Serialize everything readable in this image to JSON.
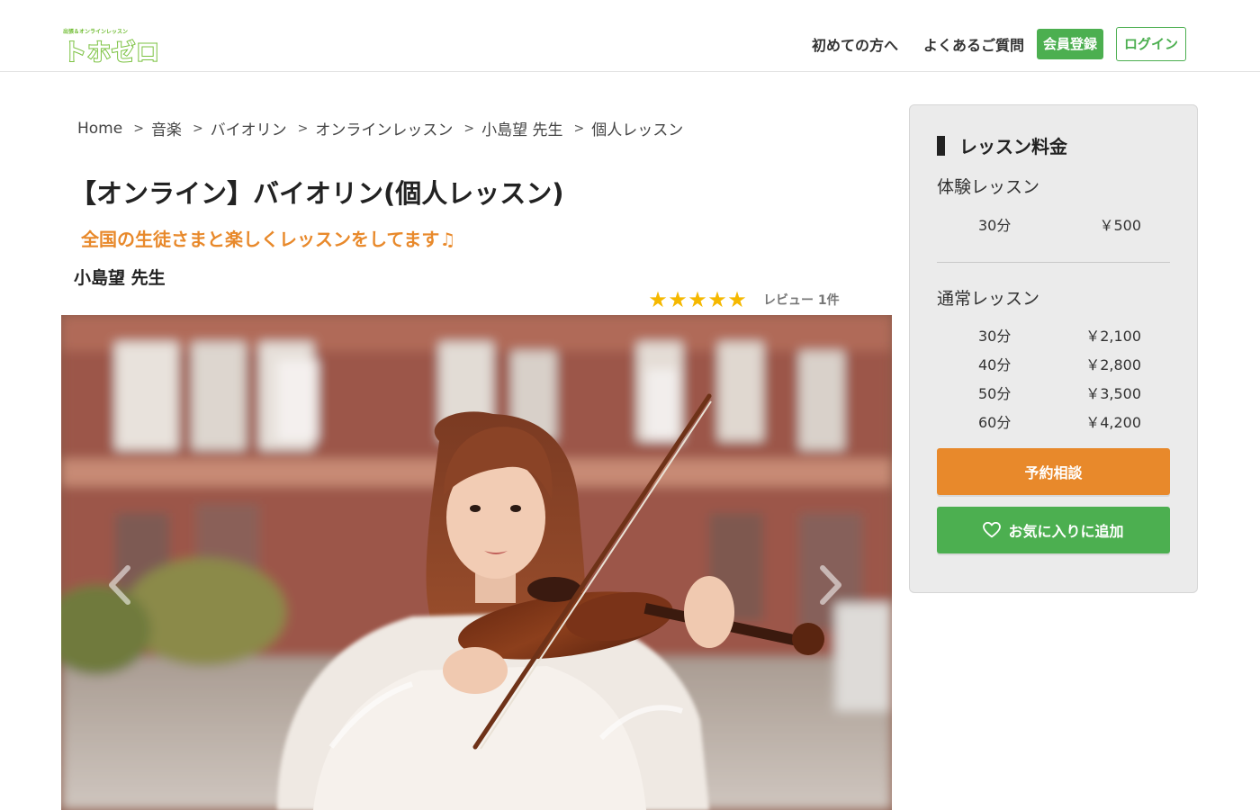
{
  "header": {
    "logo_tagline": "出張＆オンラインレッスン",
    "logo_text": "トホゼロ",
    "nav_first_time": "初めての方へ",
    "nav_faq": "よくあるご質問",
    "register_label": "会員登録",
    "login_label": "ログイン"
  },
  "breadcrumb": {
    "items": [
      "Home",
      "音楽",
      "バイオリン",
      "オンラインレッスン",
      "小島望 先生",
      "個人レッスン"
    ],
    "separator": ">"
  },
  "lesson": {
    "title": "【オンライン】バイオリン(個人レッスン)",
    "catch_copy": "全国の生徒さまと楽しくレッスンをしてます♫",
    "teacher": "小島望 先生",
    "rating": 5,
    "rating_max": 5,
    "review_label": "レビュー 1件"
  },
  "gallery": {
    "photo": "woman-playing-violin-photo",
    "prev_icon": "chevron-left-icon",
    "next_icon": "chevron-right-icon"
  },
  "pricing": {
    "title": "レッスン料金",
    "trial": {
      "label": "体験レッスン",
      "rows": [
        {
          "duration": "30分",
          "price": "￥500"
        }
      ]
    },
    "regular": {
      "label": "通常レッスン",
      "rows": [
        {
          "duration": "30分",
          "price": "￥2,100"
        },
        {
          "duration": "40分",
          "price": "￥2,800"
        },
        {
          "duration": "50分",
          "price": "￥3,500"
        },
        {
          "duration": "60分",
          "price": "￥4,200"
        }
      ]
    },
    "reserve_label": "予約相談",
    "favorite_label": "お気に入りに追加",
    "favorite_icon": "heart-icon"
  },
  "colors": {
    "brand_green": "#4caf50",
    "accent_orange": "#e8892b",
    "star_yellow": "#f5b800"
  }
}
